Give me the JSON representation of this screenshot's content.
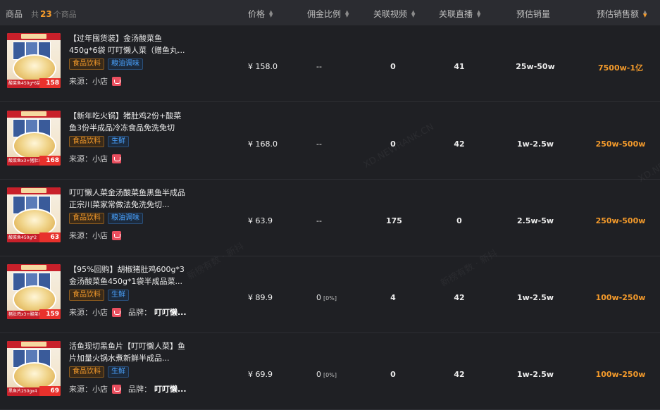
{
  "header": {
    "products_label": "商品",
    "count_prefix": "共",
    "count": "23",
    "count_suffix": "个商品",
    "columns": {
      "price": "价格",
      "commission": "佣金比例",
      "videos": "关联视频",
      "live": "关联直播",
      "est_sales": "预估销量",
      "est_revenue": "预估销售额"
    }
  },
  "labels": {
    "source": "来源：",
    "brand": "品牌："
  },
  "rows": [
    {
      "title": "【过年囤货装】金汤酸菜鱼450g*6袋 叮叮懒人菜（赠鱼丸...",
      "tag1": "食品饮料",
      "tag2": "粮油调味",
      "source": "小店",
      "brand": "",
      "thumb_caption": "酸菜鱼450g*6袋",
      "thumb_price": "158",
      "price": "¥ 158.0",
      "commission": "--",
      "commission_pct": "",
      "videos": "0",
      "live": "41",
      "sales": "25w-50w",
      "revenue": "7500w-1亿"
    },
    {
      "title": "【新年吃火锅】猪肚鸡2份+酸菜鱼3份半成品冷冻食品免洗免切",
      "tag1": "食品饮料",
      "tag2": "生鲜",
      "source": "小店",
      "brand": "",
      "thumb_caption": "酸菜鱼x3+猪肚鸡x2",
      "thumb_price": "168",
      "price": "¥ 168.0",
      "commission": "--",
      "commission_pct": "",
      "videos": "0",
      "live": "42",
      "sales": "1w-2.5w",
      "revenue": "250w-500w"
    },
    {
      "title": "叮叮懒人菜金汤酸菜鱼黑鱼半成品正宗川菜家常做法免洗免切...",
      "tag1": "食品饮料",
      "tag2": "粮油调味",
      "source": "小店",
      "brand": "",
      "thumb_caption": "酸菜鱼450g*2",
      "thumb_price": "63",
      "price": "¥ 63.9",
      "commission": "--",
      "commission_pct": "",
      "videos": "175",
      "live": "0",
      "sales": "2.5w-5w",
      "revenue": "250w-500w"
    },
    {
      "title": "【95%回购】胡椒猪肚鸡600g*3金汤酸菜鱼450g*1袋半成品菜...",
      "tag1": "食品饮料",
      "tag2": "生鲜",
      "source": "小店",
      "brand": "叮叮懒...",
      "thumb_caption": "猪肚鸡x3+酸菜鱼x1",
      "thumb_price": "159",
      "price": "¥ 89.9",
      "commission": "0",
      "commission_pct": "[0%]",
      "videos": "4",
      "live": "42",
      "sales": "1w-2.5w",
      "revenue": "100w-250w"
    },
    {
      "title": "活鱼现切黑鱼片【叮叮懒人菜】鱼片加量火锅水煮新鲜半成品...",
      "tag1": "食品饮料",
      "tag2": "生鲜",
      "source": "小店",
      "brand": "叮叮懒...",
      "thumb_caption": "黑鱼片250gx4",
      "thumb_price": "69",
      "price": "¥ 69.9",
      "commission": "0",
      "commission_pct": "[0%]",
      "videos": "0",
      "live": "42",
      "sales": "1w-2.5w",
      "revenue": "100w-250w"
    }
  ],
  "watermark": "XD.NEWRANK.CN",
  "watermark2": "新榜有数 · 新抖"
}
